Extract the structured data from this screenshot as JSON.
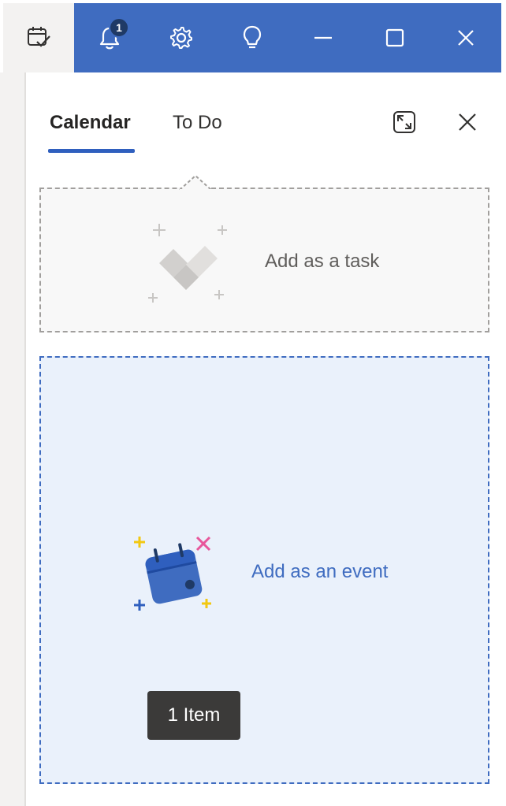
{
  "titlebar": {
    "notification_count": "1",
    "buttons": {
      "my_day": "calendar-check-icon",
      "notifications": "bell-icon",
      "settings": "gear-icon",
      "tips": "lightbulb-icon",
      "minimize": "minimize-icon",
      "maximize": "maximize-icon",
      "close": "close-icon"
    },
    "accent_color": "#3f6cc0"
  },
  "panel": {
    "tabs": [
      {
        "label": "Calendar",
        "selected": true
      },
      {
        "label": "To Do",
        "selected": false
      }
    ],
    "expand_icon": "expand-icon",
    "close_icon": "close-icon"
  },
  "drop_zones": {
    "task": {
      "label": "Add as a task",
      "icon": "checkmark-sparkle-icon"
    },
    "event": {
      "label": "Add as an event",
      "icon": "calendar-sparkle-icon"
    }
  },
  "drag_tooltip": {
    "label": "1 Item"
  }
}
